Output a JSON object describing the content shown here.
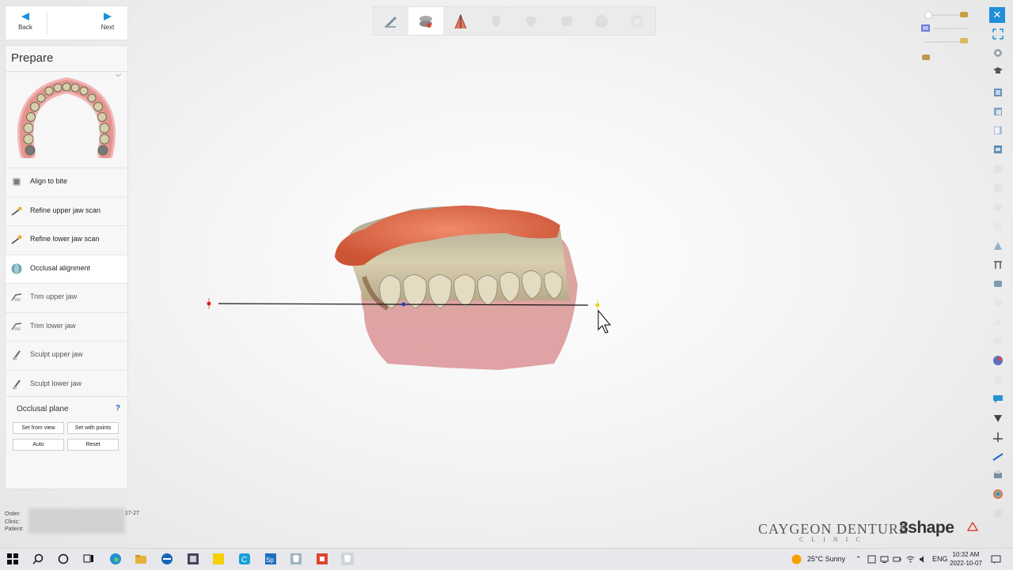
{
  "nav": {
    "back_label": "Back",
    "next_label": "Next"
  },
  "panel": {
    "title": "Prepare",
    "steps": [
      {
        "label": "Align to bite"
      },
      {
        "label": "Refine upper jaw scan"
      },
      {
        "label": "Refine lower jaw scan"
      },
      {
        "label": "Occlusal alignment"
      },
      {
        "label": "Trim upper jaw"
      },
      {
        "label": "Trim lower jaw"
      },
      {
        "label": "Sculpt upper jaw"
      },
      {
        "label": "Sculpt lower jaw"
      }
    ]
  },
  "occlusal": {
    "title": "Occlusal plane",
    "help": "?",
    "set_from_view": "Set from view",
    "set_with_points": "Set with points",
    "auto": "Auto",
    "reset": "Reset"
  },
  "patient": {
    "order_label": "Order:",
    "clinic_label": "Clinic:",
    "patient_label": "Patient:",
    "order_suffix": "17-27"
  },
  "logos": {
    "clinic": "CAYGEON DENTURE",
    "clinic_sub": "CLINIC",
    "brand": "3shape"
  },
  "colors": {
    "accent": "#1e8fd8",
    "gum": "#e8694f"
  },
  "taskbar": {
    "weather": "25°C  Sunny",
    "language": "ENG",
    "time": "10:32 AM",
    "date": "2022-10-07"
  }
}
